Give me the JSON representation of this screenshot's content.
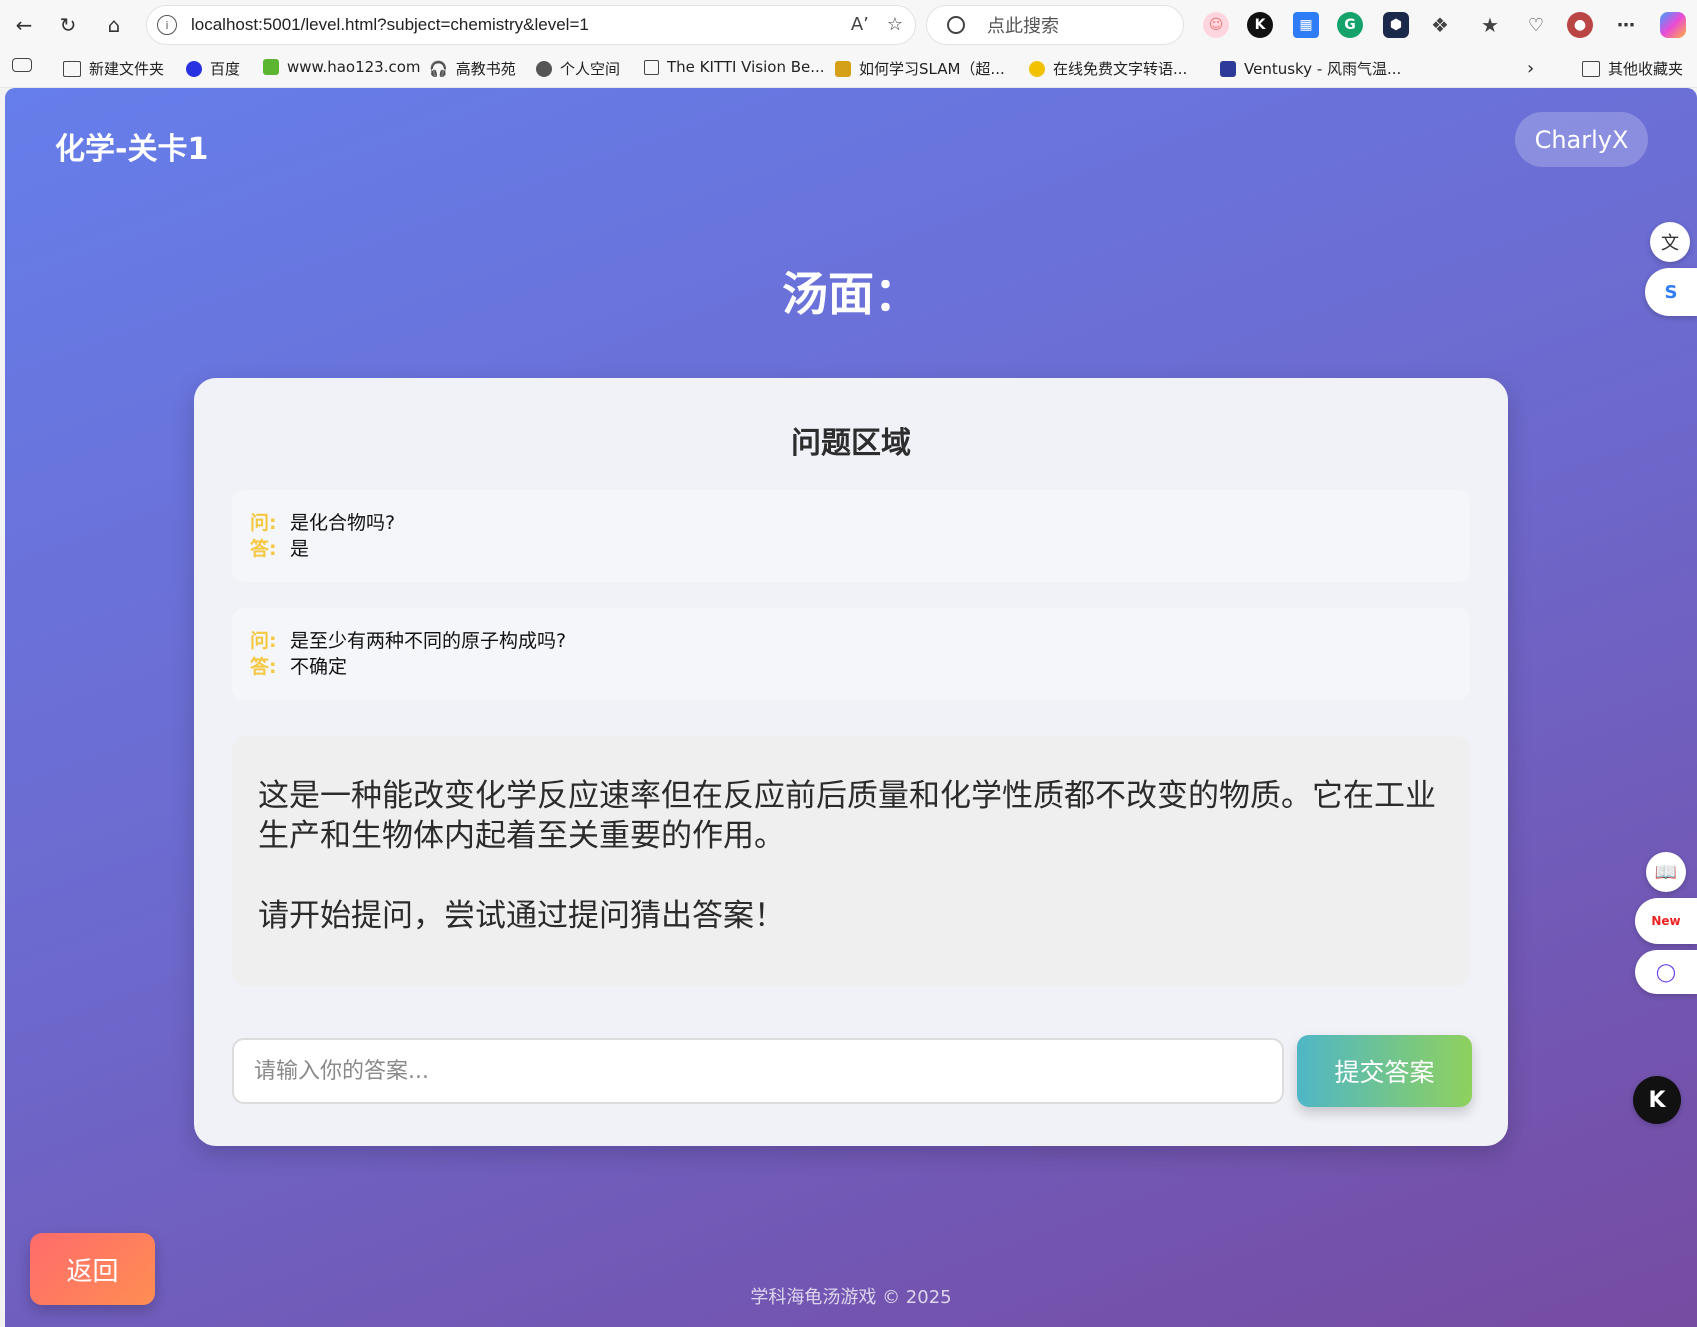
{
  "browser": {
    "url": "localhost:5001/level.html?subject=chemistry&level=1",
    "search_placeholder": "点此搜索",
    "bookmarks": [
      {
        "label": "新建文件夹"
      },
      {
        "label": "百度"
      },
      {
        "label": "www.hao123.com"
      },
      {
        "label": "高教书苑"
      },
      {
        "label": "个人空间"
      },
      {
        "label": "The KITTI Vision Be..."
      },
      {
        "label": "如何学习SLAM（超..."
      },
      {
        "label": "在线免费文字转语..."
      },
      {
        "label": "Ventusky - 风雨气温..."
      },
      {
        "label": "其他收藏夹"
      }
    ]
  },
  "header": {
    "title": "化学-关卡1",
    "user": "CharlyX"
  },
  "soup_title": "汤面：",
  "question_area": {
    "title": "问题区域",
    "q_label": "问:",
    "a_label": "答:",
    "items": [
      {
        "question": "是化合物吗?",
        "answer": "是"
      },
      {
        "question": "是至少有两种不同的原子构成吗?",
        "answer": "不确定"
      }
    ],
    "story": "这是一种能改变化学反应速率但在反应前后质量和化学性质都不改变的物质。它在工业生产和生物体内起着至关重要的作用。",
    "prompt": "请开始提问，尝试通过提问猜出答案！",
    "input_placeholder": "请输入你的答案...",
    "submit_label": "提交答案"
  },
  "back_label": "返回",
  "footer": "学科海龟汤游戏 © 2025",
  "extension_icons": [
    "cat-extension-icon",
    "k-extension-icon",
    "translate-extension-icon",
    "grammarly-icon",
    "hexagon-extension-icon",
    "puzzle-icon"
  ]
}
